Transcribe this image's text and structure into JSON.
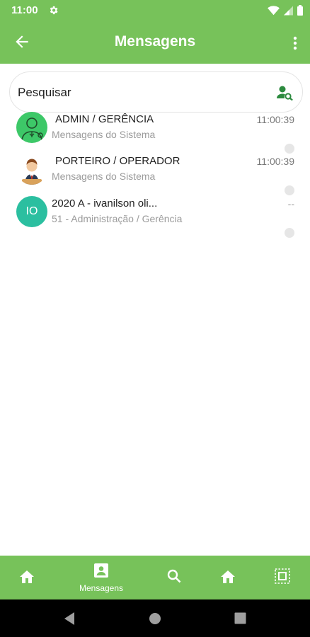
{
  "status_bar": {
    "time": "11:00"
  },
  "app_bar": {
    "title": "Mensagens"
  },
  "search": {
    "placeholder": "Pesquisar"
  },
  "conversations": [
    {
      "name": "ADMIN / GERÊNCIA",
      "subtitle": "Mensagens do Sistema",
      "time": "11:00:39"
    },
    {
      "name": "PORTEIRO / OPERADOR",
      "subtitle": "Mensagens do Sistema",
      "time": "11:00:39"
    },
    {
      "name": "2020 A - ivanilson oli...",
      "subtitle": "51 - Administração / Gerência",
      "time": "--",
      "initials": "IO"
    }
  ],
  "bottom_nav": {
    "active_label": "Mensagens"
  },
  "colors": {
    "primary": "#77c25a",
    "avatar_teal": "#2bbfa0",
    "system_nav": "#000000"
  },
  "icons": [
    "gear-icon",
    "wifi-icon",
    "signal-icon",
    "battery-icon",
    "back-arrow-icon",
    "more-vert-icon",
    "search-user-icon",
    "home-icon",
    "contact-icon",
    "search-icon",
    "scan-icon",
    "back-triangle-icon",
    "home-circle-icon",
    "recents-square-icon"
  ]
}
